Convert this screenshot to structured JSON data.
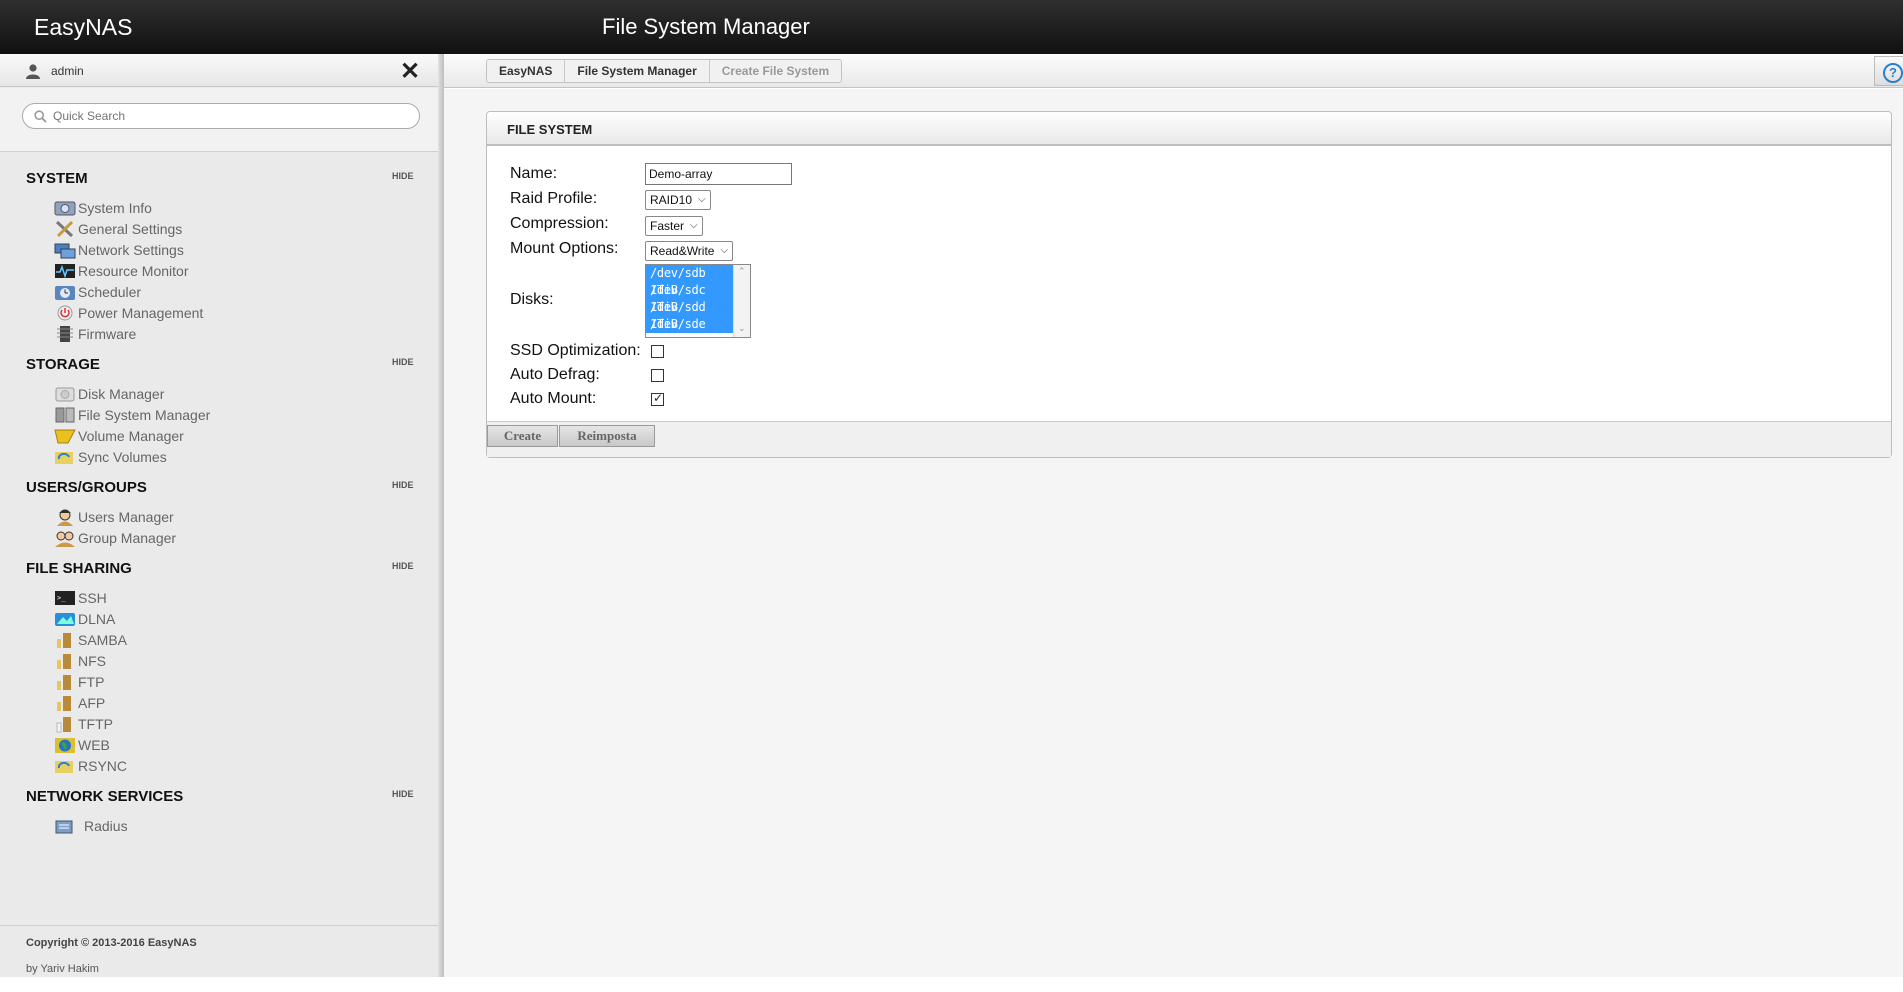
{
  "app": {
    "brand": "EasyNAS",
    "page_title": "File System Manager"
  },
  "user": {
    "name": "admin"
  },
  "search": {
    "placeholder": "Quick Search"
  },
  "sections": {
    "system": {
      "title": "SYSTEM",
      "hide": "HIDE",
      "items": [
        "System Info",
        "General Settings",
        "Network Settings",
        "Resource Monitor",
        "Scheduler",
        "Power Management",
        "Firmware"
      ]
    },
    "storage": {
      "title": "STORAGE",
      "hide": "HIDE",
      "items": [
        "Disk Manager",
        "File System Manager",
        "Volume Manager",
        "Sync Volumes"
      ]
    },
    "users": {
      "title": "USERS/GROUPS",
      "hide": "HIDE",
      "items": [
        "Users Manager",
        "Group Manager"
      ]
    },
    "sharing": {
      "title": "FILE SHARING",
      "hide": "HIDE",
      "items": [
        "SSH",
        "DLNA",
        "SAMBA",
        "NFS",
        "FTP",
        "AFP",
        "TFTP",
        "WEB",
        "RSYNC"
      ]
    },
    "network": {
      "title": "NETWORK SERVICES",
      "hide": "HIDE",
      "items": [
        "Radius"
      ]
    }
  },
  "footer": {
    "copyright": "Copyright © 2013-2016 EasyNAS",
    "author": "by Yariv Hakim"
  },
  "breadcrumb": [
    "EasyNAS",
    "File System Manager",
    "Create File System"
  ],
  "help": {
    "label": "?"
  },
  "panel": {
    "title": "FILE SYSTEM",
    "labels": {
      "name": "Name:",
      "raid": "Raid Profile:",
      "compression": "Compression:",
      "mount": "Mount Options:",
      "disks": "Disks:",
      "ssd": "SSD Optimization:",
      "defrag": "Auto Defrag:",
      "automount": "Auto Mount:"
    },
    "values": {
      "name": "Demo-array",
      "raid": "RAID10",
      "compression": "Faster",
      "mount": "Read&Write",
      "disks": [
        "/dev/sdb 1TiB",
        "/dev/sdc 1TiB",
        "/dev/sdd 1TiB",
        "/dev/sde 1TiB"
      ],
      "ssd": false,
      "defrag": false,
      "automount": true
    },
    "buttons": {
      "create": "Create",
      "reset": "Reimposta"
    }
  }
}
